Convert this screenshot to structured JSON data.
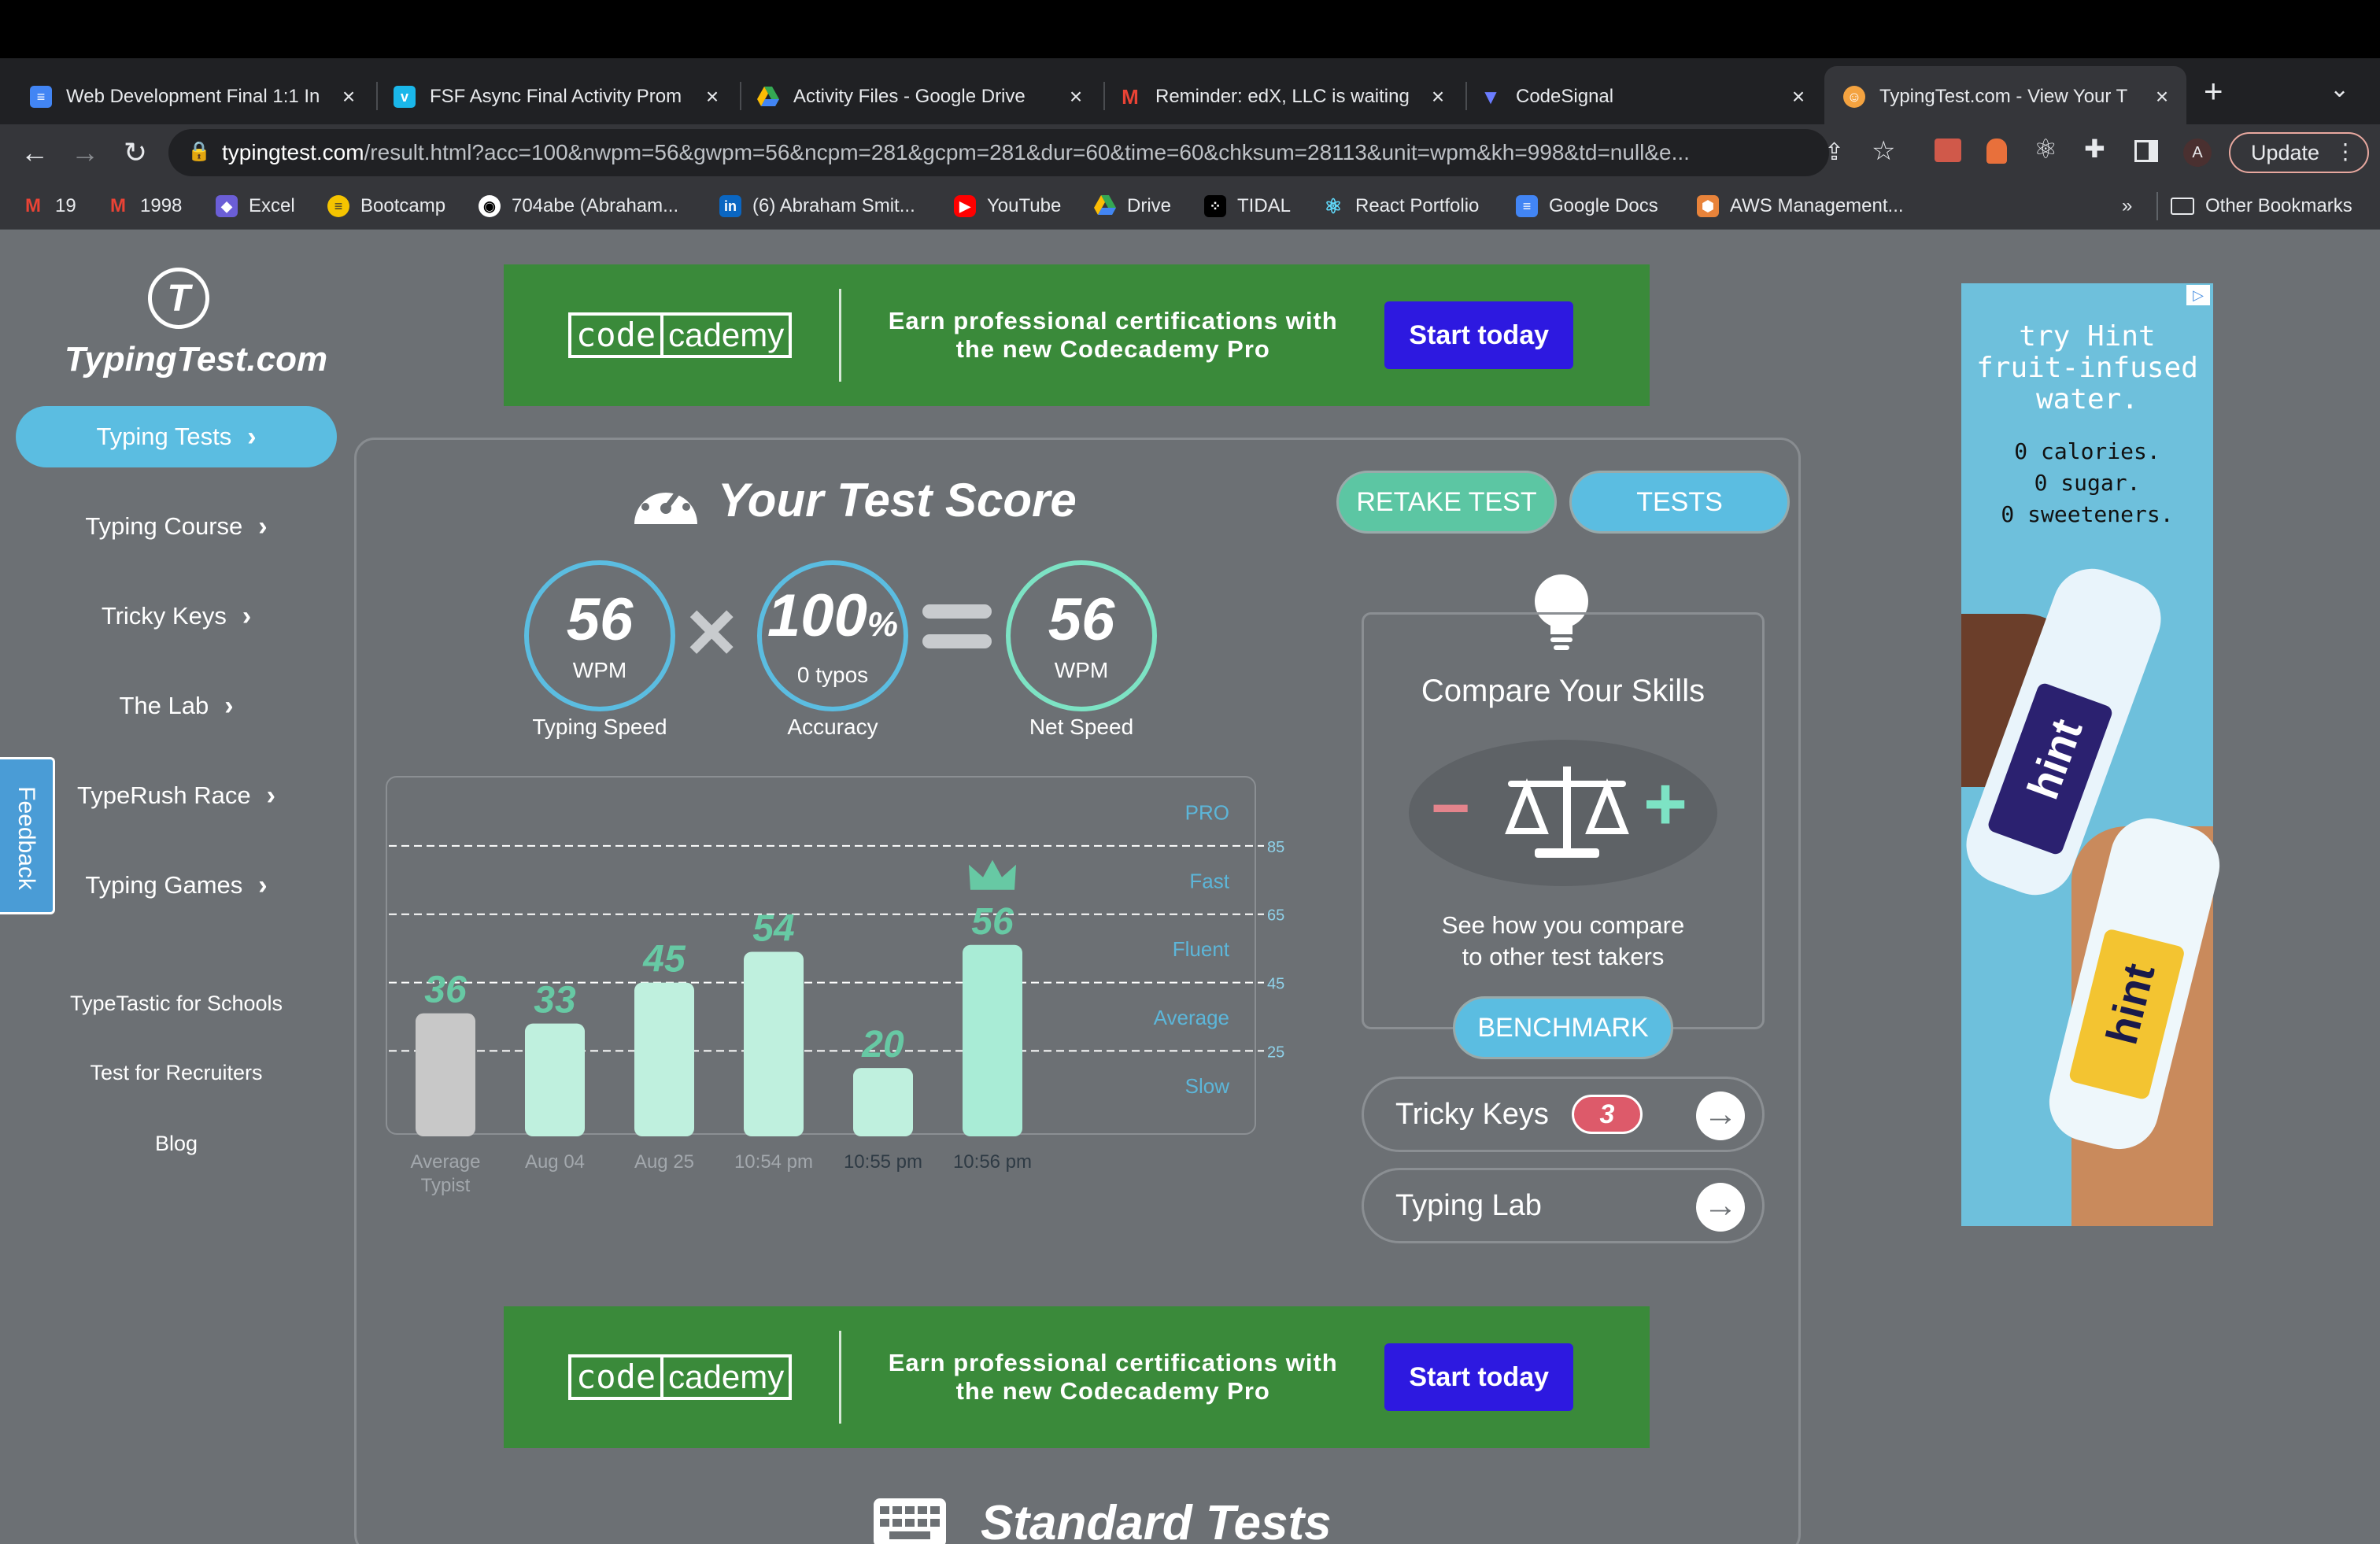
{
  "browser": {
    "tabs": [
      {
        "title": "Web Development Final 1:1 In",
        "icon": "google-docs-icon",
        "color": "#4285f4"
      },
      {
        "title": "FSF Async Final Activity Prom",
        "icon": "vimeo-icon",
        "color": "#1ab7ea"
      },
      {
        "title": "Activity Files - Google Drive",
        "icon": "google-drive-icon",
        "color": "#34a853"
      },
      {
        "title": "Reminder: edX, LLC is waiting",
        "icon": "gmail-icon",
        "color": "#ea4335"
      },
      {
        "title": "CodeSignal",
        "icon": "codesignal-icon",
        "color": "#6a7cff"
      },
      {
        "title": "TypingTest.com - View Your T",
        "icon": "typingtest-icon",
        "color": "#f4a340",
        "active": true
      }
    ],
    "new_tab": "+",
    "url_host": "typingtest.com",
    "url_path": "/result.html?acc=100&nwpm=56&gwpm=56&ncpm=281&gcpm=281&dur=60&time=60&chksum=28113&unit=wpm&kh=998&td=null&e...",
    "update_label": "Update",
    "profile_initial": "A",
    "bookmarks": [
      {
        "label": "19",
        "icon": "gmail-icon"
      },
      {
        "label": "1998",
        "icon": "gmail-icon"
      },
      {
        "label": "Excel",
        "icon": "excel-icon"
      },
      {
        "label": "Bootcamp",
        "icon": "bootcamp-icon"
      },
      {
        "label": "704abe (Abraham...",
        "icon": "github-icon"
      },
      {
        "label": "(6) Abraham Smit...",
        "icon": "linkedin-icon"
      },
      {
        "label": "YouTube",
        "icon": "youtube-icon"
      },
      {
        "label": "Drive",
        "icon": "google-drive-icon"
      },
      {
        "label": "TIDAL",
        "icon": "tidal-icon"
      },
      {
        "label": "React Portfolio",
        "icon": "react-icon"
      },
      {
        "label": "Google Docs",
        "icon": "google-docs-icon"
      },
      {
        "label": "AWS Management...",
        "icon": "aws-icon"
      }
    ],
    "more_bookmarks": "»",
    "other_bookmarks": "Other Bookmarks"
  },
  "sidebar": {
    "logo_text": "TypingTest.com",
    "nav": [
      {
        "label": "Typing Tests",
        "active": true
      },
      {
        "label": "Typing Course"
      },
      {
        "label": "Tricky Keys"
      },
      {
        "label": "The Lab"
      },
      {
        "label": "TypeRush Race"
      },
      {
        "label": "Typing Games"
      }
    ],
    "links": [
      "TypeTastic for Schools",
      "Test for Recruiters",
      "Blog"
    ],
    "feedback": "Feedback"
  },
  "ad_banner": {
    "logo_left": "code",
    "logo_right": "cademy",
    "text_line1": "Earn professional certifications with",
    "text_line2": "the new Codecademy Pro",
    "button": "Start today"
  },
  "score": {
    "title": "Your Test Score",
    "retake": "RETAKE TEST",
    "tests": "TESTS",
    "typing_speed": {
      "value": "56",
      "unit": "WPM",
      "label": "Typing Speed"
    },
    "accuracy": {
      "value": "100",
      "pct": "%",
      "sub": "0  typos",
      "label": "Accuracy"
    },
    "net_speed": {
      "value": "56",
      "unit": "WPM",
      "label": "Net Speed"
    },
    "times": "×",
    "equals": "="
  },
  "chart_data": {
    "type": "bar",
    "categories": [
      "Average Typist",
      "Aug 04",
      "Aug 25",
      "10:54 pm",
      "10:55 pm",
      "10:56 pm"
    ],
    "values": [
      36,
      33,
      45,
      54,
      20,
      56
    ],
    "ylim": [
      0,
      105
    ],
    "levels": [
      {
        "name": "PRO",
        "value": 95
      },
      {
        "name": "Fast",
        "value": 75
      },
      {
        "name": "Fluent",
        "value": 55
      },
      {
        "name": "Average",
        "value": 35
      },
      {
        "name": "Slow",
        "value": 15
      }
    ],
    "thresholds": [
      85,
      65,
      45,
      25
    ],
    "highlight_index": 5,
    "colors": {
      "average": "#c8c8c8",
      "bar": "#bff0de",
      "current": "#a9ecd6",
      "label": "#67c9a4"
    }
  },
  "compare": {
    "title": "Compare Your Skills",
    "text_line1": "See how you compare",
    "text_line2": "to other test takers",
    "button": "BENCHMARK",
    "minus": "−",
    "plus": "+"
  },
  "tricky_keys": {
    "label": "Tricky Keys",
    "count": "3"
  },
  "typing_lab": {
    "label": "Typing Lab"
  },
  "right_ad": {
    "line1": "try Hint",
    "line2": "fruit-infused",
    "line3": "water.",
    "facts": [
      "0 calories.",
      "0 sugar.",
      "0 sweeteners."
    ],
    "brand": "hint"
  },
  "standard_tests": {
    "title": "Standard Tests"
  }
}
